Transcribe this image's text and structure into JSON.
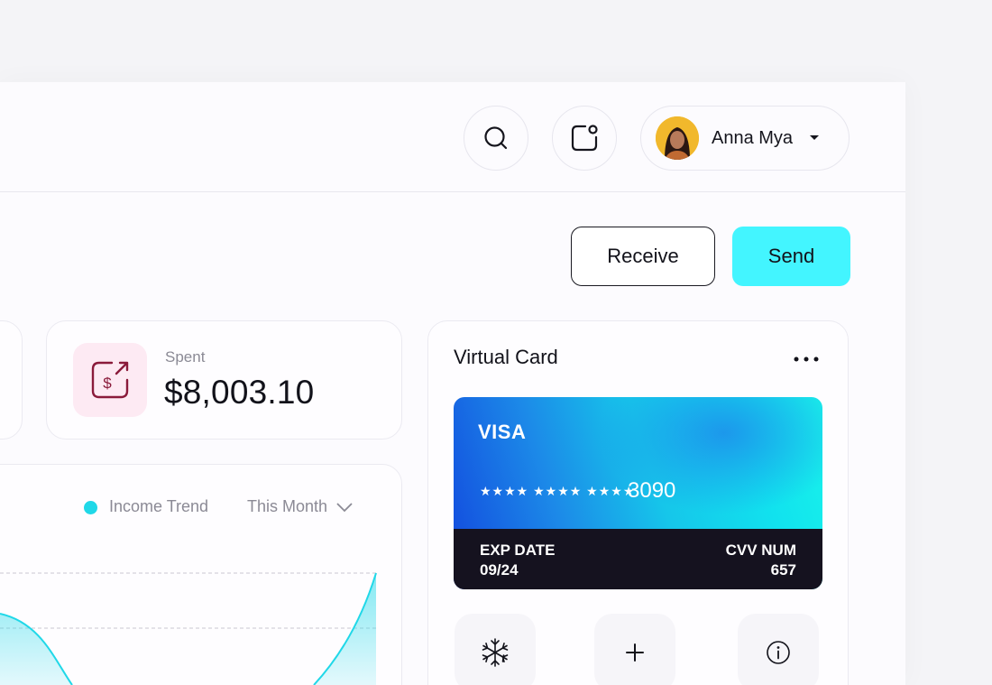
{
  "header": {
    "search_icon": "search-icon",
    "notification_icon": "notification-icon",
    "user": {
      "name": "Anna Mya",
      "avatar": "avatar"
    }
  },
  "actions": {
    "receive_label": "Receive",
    "send_label": "Send"
  },
  "stats": {
    "spent": {
      "label": "Spent",
      "value": "$8,003.10",
      "icon": "dollar-out-icon"
    }
  },
  "chart": {
    "legend_label": "Income Trend",
    "period_label": "This Month",
    "series_color": "#20d8e8"
  },
  "virtual_card": {
    "title": "Virtual Card",
    "brand": "VISA",
    "masked_number": "★★★★ ★★★★ ★★★★",
    "last_four": "3090",
    "exp_label": "EXP DATE",
    "exp_value": "09/24",
    "cvv_label": "CVV NUM",
    "cvv_value": "657",
    "card_actions": [
      "snowflake-icon",
      "plus-icon",
      "info-icon"
    ]
  },
  "colors": {
    "accent": "#43f5ff",
    "spent_icon_bg": "#fdeaf3",
    "spent_icon": "#8a1a3a"
  }
}
